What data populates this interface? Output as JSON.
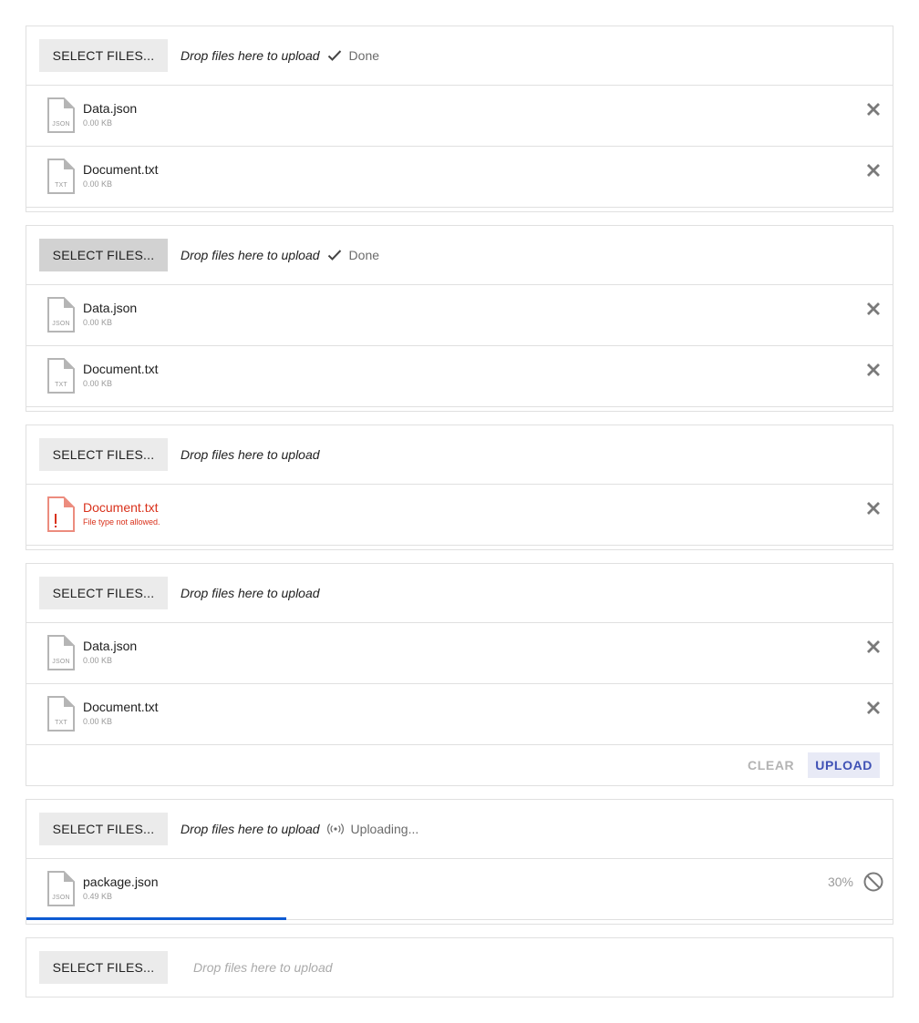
{
  "common": {
    "select_label": "SELECT FILES...",
    "drop_hint": "Drop files here to upload"
  },
  "uploads": [
    {
      "status": "Done",
      "files": [
        {
          "name": "Data.json",
          "size": "0.00 KB",
          "ext": "JSON"
        },
        {
          "name": "Document.txt",
          "size": "0.00 KB",
          "ext": "TXT"
        }
      ]
    },
    {
      "status": "Done",
      "files": [
        {
          "name": "Data.json",
          "size": "0.00 KB",
          "ext": "JSON"
        },
        {
          "name": "Document.txt",
          "size": "0.00 KB",
          "ext": "TXT"
        }
      ]
    },
    {
      "files": [
        {
          "name": "Document.txt",
          "error": "File type not allowed."
        }
      ]
    },
    {
      "files": [
        {
          "name": "Data.json",
          "size": "0.00 KB",
          "ext": "JSON"
        },
        {
          "name": "Document.txt",
          "size": "0.00 KB",
          "ext": "TXT"
        }
      ],
      "actions": {
        "clear": "CLEAR",
        "upload": "UPLOAD"
      }
    },
    {
      "status": "Uploading...",
      "files": [
        {
          "name": "package.json",
          "size": "0.49 KB",
          "ext": "JSON",
          "progress_label": "30%",
          "progress": 0.3
        }
      ]
    },
    {
      "disabled": true
    }
  ],
  "colors": {
    "progress": "#0d5bd2",
    "error": "#d9321c",
    "primary": "#3f51b5"
  }
}
